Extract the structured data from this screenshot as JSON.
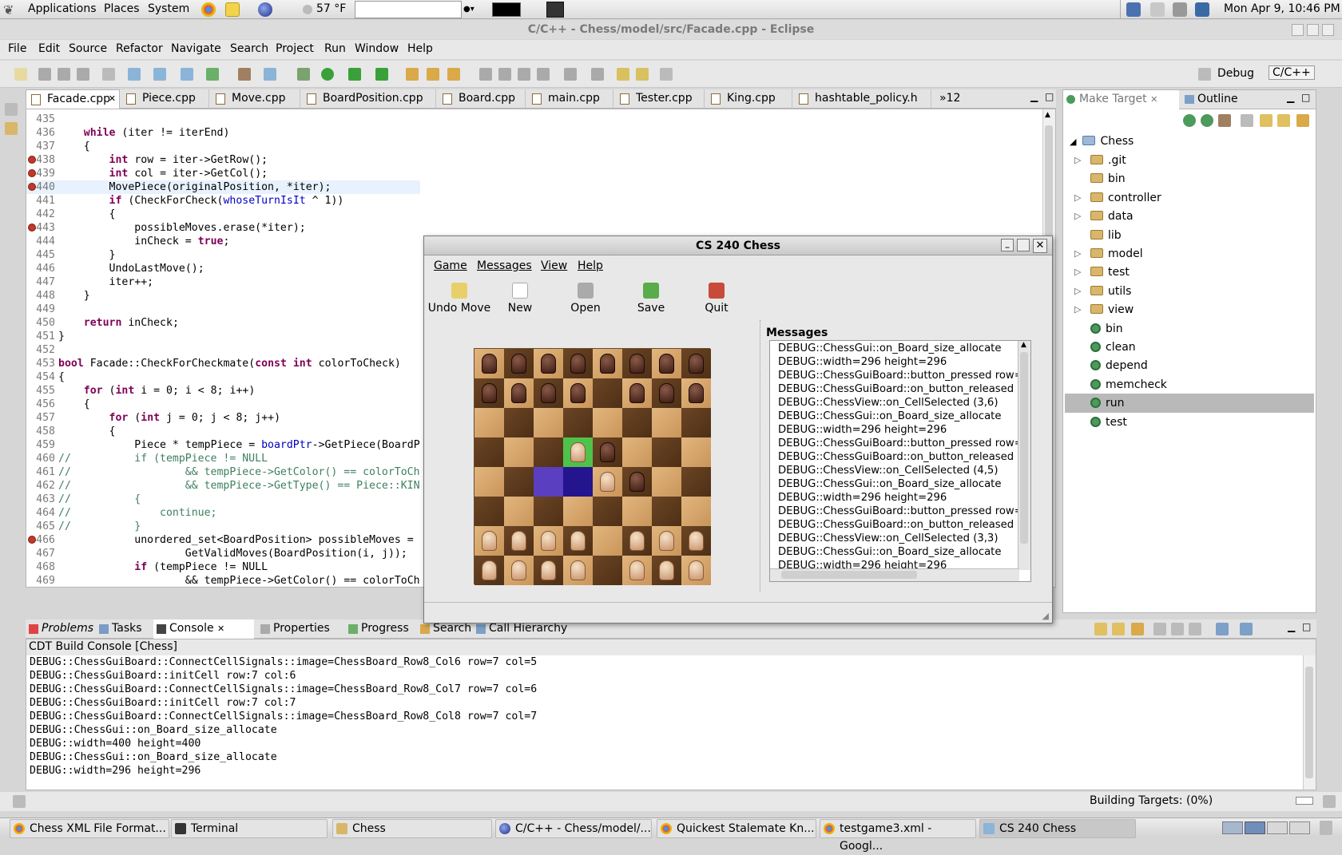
{
  "top_panel": {
    "menus": [
      "Applications",
      "Places",
      "System"
    ],
    "weather": "57 °F",
    "clock": "Mon Apr  9, 10:46 PM"
  },
  "eclipse": {
    "title": "C/C++ - Chess/model/src/Facade.cpp - Eclipse",
    "menu": [
      "File",
      "Edit",
      "Source",
      "Refactor",
      "Navigate",
      "Search",
      "Project",
      "Run",
      "Window",
      "Help"
    ],
    "perspectives": {
      "debug": "Debug",
      "cpp": "C/C++"
    },
    "editor_tabs": [
      "Facade.cpp",
      "Piece.cpp",
      "Move.cpp",
      "BoardPosition.cpp",
      "Board.cpp",
      "main.cpp",
      "Tester.cpp",
      "King.cpp",
      "hashtable_policy.h"
    ],
    "editor_overflow": "»12",
    "code_lines": [
      {
        "n": "435",
        "t": ""
      },
      {
        "n": "436",
        "t": "    while (iter != iterEnd)"
      },
      {
        "n": "437",
        "t": "    {"
      },
      {
        "n": "438",
        "t": "        int row = iter->GetRow();"
      },
      {
        "n": "439",
        "t": "        int col = iter->GetCol();"
      },
      {
        "n": "440",
        "t": "        MovePiece(originalPosition, *iter);"
      },
      {
        "n": "441",
        "t": "        if (CheckForCheck(whoseTurnIsIt ^ 1))"
      },
      {
        "n": "442",
        "t": "        {"
      },
      {
        "n": "443",
        "t": "            possibleMoves.erase(*iter);"
      },
      {
        "n": "444",
        "t": "            inCheck = true;"
      },
      {
        "n": "445",
        "t": "        }"
      },
      {
        "n": "446",
        "t": "        UndoLastMove();"
      },
      {
        "n": "447",
        "t": "        iter++;"
      },
      {
        "n": "448",
        "t": "    }"
      },
      {
        "n": "449",
        "t": ""
      },
      {
        "n": "450",
        "t": "    return inCheck;"
      },
      {
        "n": "451",
        "t": "}"
      },
      {
        "n": "452",
        "t": ""
      },
      {
        "n": "453",
        "t": "bool Facade::CheckForCheckmate(const int colorToCheck)"
      },
      {
        "n": "454",
        "t": "{"
      },
      {
        "n": "455",
        "t": "    for (int i = 0; i < 8; i++)"
      },
      {
        "n": "456",
        "t": "    {"
      },
      {
        "n": "457",
        "t": "        for (int j = 0; j < 8; j++)"
      },
      {
        "n": "458",
        "t": "        {"
      },
      {
        "n": "459",
        "t": "            Piece * tempPiece = boardPtr->GetPiece(BoardP"
      },
      {
        "n": "460",
        "t": "//          if (tempPiece != NULL"
      },
      {
        "n": "461",
        "t": "//                  && tempPiece->GetColor() == colorToCh"
      },
      {
        "n": "462",
        "t": "//                  && tempPiece->GetType() == Piece::KIN"
      },
      {
        "n": "463",
        "t": "//          {"
      },
      {
        "n": "464",
        "t": "//              continue;"
      },
      {
        "n": "465",
        "t": "//          }"
      },
      {
        "n": "466",
        "t": "            unordered_set<BoardPosition> possibleMoves ="
      },
      {
        "n": "467",
        "t": "                    GetValidMoves(BoardPosition(i, j));"
      },
      {
        "n": "468",
        "t": "            if (tempPiece != NULL"
      },
      {
        "n": "469",
        "t": "                    && tempPiece->GetColor() == colorToCh"
      },
      {
        "n": "470",
        "t": "                    && !possibleMoves.empty())"
      }
    ],
    "right_tabs": [
      "Make Target",
      "Outline"
    ],
    "tree_root": "Chess",
    "tree": [
      {
        "label": ".git",
        "type": "folder",
        "expandable": true
      },
      {
        "label": "bin",
        "type": "folder",
        "expandable": false
      },
      {
        "label": "controller",
        "type": "folder",
        "expandable": true
      },
      {
        "label": "data",
        "type": "folder",
        "expandable": true
      },
      {
        "label": "lib",
        "type": "folder",
        "expandable": false
      },
      {
        "label": "model",
        "type": "folder",
        "expandable": true
      },
      {
        "label": "test",
        "type": "folder",
        "expandable": true
      },
      {
        "label": "utils",
        "type": "folder",
        "expandable": true
      },
      {
        "label": "view",
        "type": "folder",
        "expandable": true
      },
      {
        "label": "bin",
        "type": "target"
      },
      {
        "label": "clean",
        "type": "target"
      },
      {
        "label": "depend",
        "type": "target"
      },
      {
        "label": "memcheck",
        "type": "target"
      },
      {
        "label": "run",
        "type": "target",
        "selected": true
      },
      {
        "label": "test",
        "type": "target"
      }
    ],
    "bottom_tabs": [
      "Problems",
      "Tasks",
      "Console",
      "Properties",
      "Progress",
      "Search",
      "Call Hierarchy"
    ],
    "console_title": "CDT Build Console [Chess]",
    "console_lines": [
      "DEBUG::ChessGuiBoard::ConnectCellSignals::image=ChessBoard_Row8_Col6 row=7 col=5",
      "DEBUG::ChessGuiBoard::initCell row:7 col:6",
      "DEBUG::ChessGuiBoard::ConnectCellSignals::image=ChessBoard_Row8_Col7 row=7 col=6",
      "DEBUG::ChessGuiBoard::initCell row:7 col:7",
      "DEBUG::ChessGuiBoard::ConnectCellSignals::image=ChessBoard_Row8_Col8 row=7 col=7",
      "DEBUG::ChessGui::on_Board_size_allocate",
      "DEBUG::width=400 height=400",
      "DEBUG::ChessGui::on_Board_size_allocate",
      "DEBUG::width=296 height=296"
    ],
    "status": "Building Targets: (0%)"
  },
  "chess_window": {
    "title": "CS 240 Chess",
    "menu": [
      "Game",
      "Messages",
      "View",
      "Help"
    ],
    "toolbar": [
      "Undo Move",
      "New",
      "Open",
      "Save",
      "Quit"
    ],
    "messages_label": "Messages",
    "messages": [
      "DEBUG::ChessGui::on_Board_size_allocate",
      "DEBUG::width=296 height=296",
      "DEBUG::ChessGuiBoard::button_pressed row=3",
      "DEBUG::ChessGuiBoard::on_button_released ro",
      "DEBUG::ChessView::on_CellSelected (3,6)",
      "DEBUG::ChessGui::on_Board_size_allocate",
      "DEBUG::width=296 height=296",
      "DEBUG::ChessGuiBoard::button_pressed row=4",
      "DEBUG::ChessGuiBoard::on_button_released ro",
      "DEBUG::ChessView::on_CellSelected (4,5)",
      "DEBUG::ChessGui::on_Board_size_allocate",
      "DEBUG::width=296 height=296",
      "DEBUG::ChessGuiBoard::button_pressed row=3",
      "DEBUG::ChessGuiBoard::on_button_released ro",
      "DEBUG::ChessView::on_CellSelected (3,3)",
      "DEBUG::ChessGui::on_Board_size_allocate",
      "DEBUG::width=296 height=296"
    ],
    "board": [
      "bbbbbbbb",
      "bbbb.bbb",
      "........",
      "...Wb...",
      "....wb..",
      "........",
      "wwww.www",
      "wwww.www"
    ],
    "highlight_green": [
      [
        3,
        3
      ]
    ],
    "highlight_blue": [
      [
        4,
        2
      ],
      [
        4,
        3
      ]
    ]
  },
  "taskbar": [
    "Chess XML File Format...",
    "Terminal",
    "Chess",
    "C/C++ - Chess/model/...",
    "Quickest Stalemate Kn...",
    "testgame3.xml - Googl...",
    "CS 240 Chess"
  ]
}
